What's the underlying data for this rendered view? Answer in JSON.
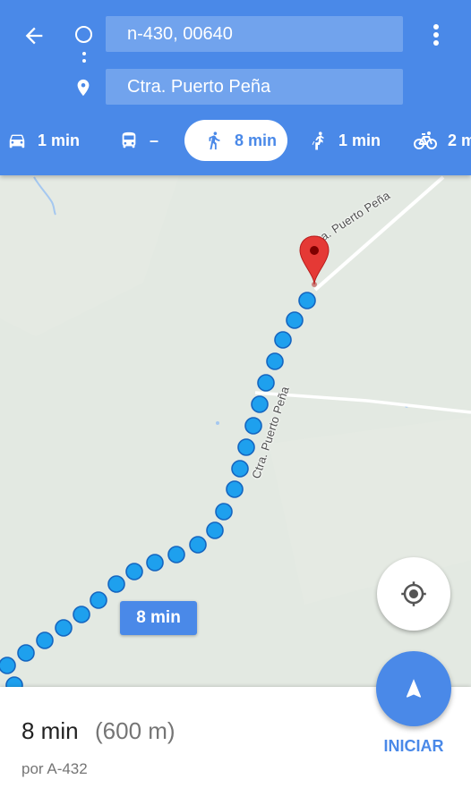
{
  "header": {
    "origin_value": "n-430, 00640",
    "destination_value": "Ctra. Puerto Peña",
    "icons": {
      "back": "arrow-left-icon",
      "more": "more-vert-icon",
      "origin": "circle-outline-icon",
      "destination": "location-pin-icon"
    }
  },
  "modes": [
    {
      "icon": "car-icon",
      "label": "1 min"
    },
    {
      "icon": "transit-icon",
      "label": "–"
    },
    {
      "icon": "walk-icon",
      "label": "8 min",
      "selected": true
    },
    {
      "icon": "ride-icon",
      "label": "1 min"
    },
    {
      "icon": "bike-icon",
      "label": "2 m"
    }
  ],
  "map": {
    "road_label_top": "Ctra. Puerto Peña",
    "road_label_route": "Ctra. Puerto Peña",
    "duration_bubble": "8 min",
    "route_color": "#1ea0ee",
    "accent_color": "#4a89e8",
    "marker_color": "#e53935"
  },
  "sheet": {
    "time": "8 min",
    "distance": "(600 m)",
    "via": "por A-432",
    "start_label": "INICIAR"
  }
}
